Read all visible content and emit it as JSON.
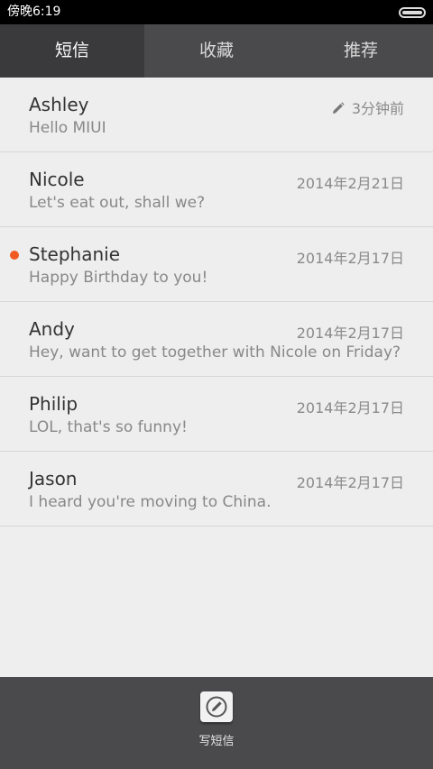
{
  "status_bar": {
    "time": "傍晚6:19"
  },
  "tabs": [
    {
      "label": "短信",
      "active": true
    },
    {
      "label": "收藏",
      "active": false
    },
    {
      "label": "推荐",
      "active": false
    }
  ],
  "messages": [
    {
      "name": "Ashley",
      "preview": "Hello MIUI",
      "date": "3分钟前",
      "draft": true,
      "unread": false
    },
    {
      "name": "Nicole",
      "preview": "Let's eat out, shall we?",
      "date": "2014年2月21日",
      "draft": false,
      "unread": false
    },
    {
      "name": "Stephanie",
      "preview": "Happy Birthday to you!",
      "date": "2014年2月17日",
      "draft": false,
      "unread": true
    },
    {
      "name": "Andy",
      "preview": "Hey, want to get together with Nicole on Friday?",
      "date": "2014年2月17日",
      "draft": false,
      "unread": false
    },
    {
      "name": "Philip",
      "preview": "LOL, that's so funny!",
      "date": "2014年2月17日",
      "draft": false,
      "unread": false
    },
    {
      "name": "Jason",
      "preview": "I heard you're moving to China.",
      "date": "2014年2月17日",
      "draft": false,
      "unread": false
    }
  ],
  "bottom_bar": {
    "compose_label": "写短信",
    "compose_icon": "compose-icon"
  },
  "colors": {
    "accent": "#f15a22",
    "tab_bar": "#4a4a4d",
    "tab_active": "#3a393c"
  }
}
